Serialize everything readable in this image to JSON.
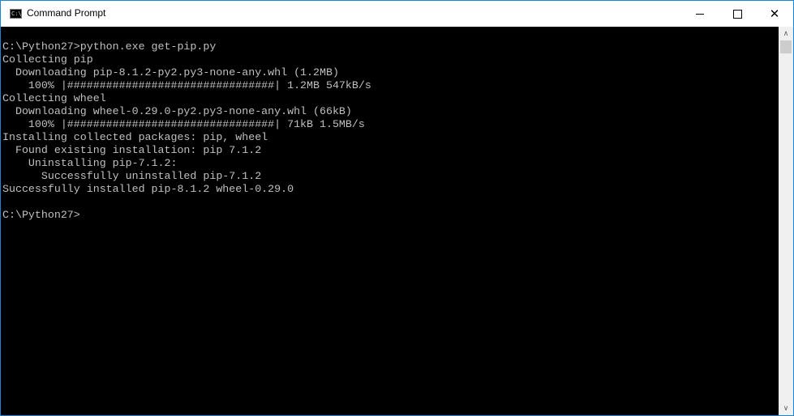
{
  "window": {
    "title": "Command Prompt",
    "icon": "cmd-icon",
    "icon_text": "C:\\_",
    "controls": {
      "minimize": "minimize-icon",
      "maximize": "maximize-icon",
      "close": "close-icon",
      "close_glyph": "✕"
    }
  },
  "console": {
    "lines": [
      "C:\\Python27>python.exe get-pip.py",
      "Collecting pip",
      "  Downloading pip-8.1.2-py2.py3-none-any.whl (1.2MB)",
      "    100% |################################| 1.2MB 547kB/s",
      "Collecting wheel",
      "  Downloading wheel-0.29.0-py2.py3-none-any.whl (66kB)",
      "    100% |################################| 71kB 1.5MB/s",
      "Installing collected packages: pip, wheel",
      "  Found existing installation: pip 7.1.2",
      "    Uninstalling pip-7.1.2:",
      "      Successfully uninstalled pip-7.1.2",
      "Successfully installed pip-8.1.2 wheel-0.29.0",
      "",
      "C:\\Python27>"
    ]
  },
  "scrollbar": {
    "up_glyph": "∧",
    "down_glyph": "∨"
  }
}
